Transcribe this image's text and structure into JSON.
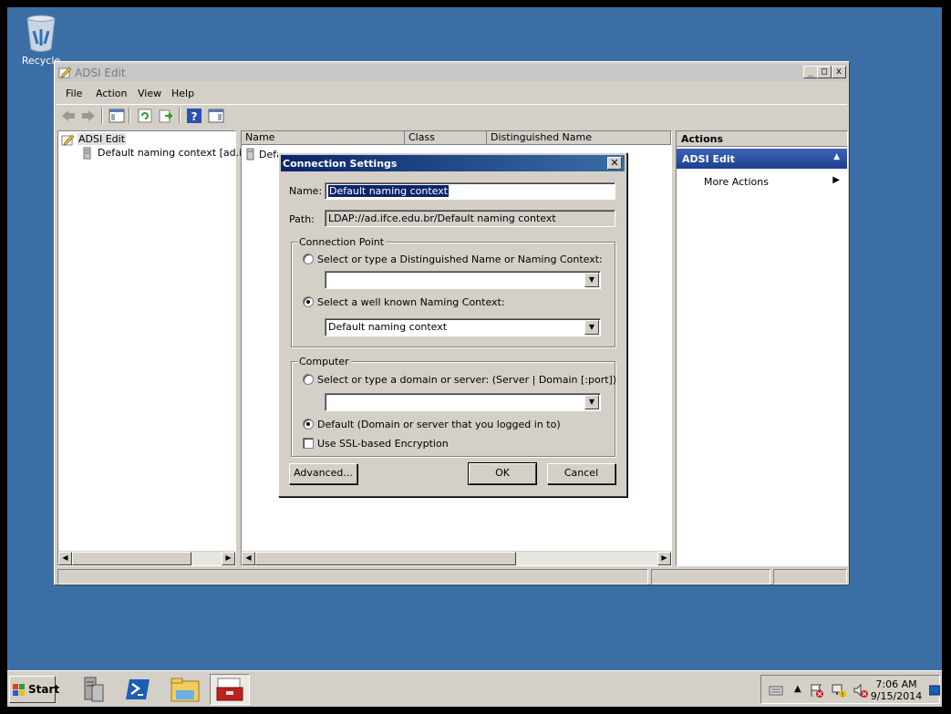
{
  "desktop": {
    "recycle_bin_label": "Recycle"
  },
  "window": {
    "title": "ADSI Edit",
    "minimize": "_",
    "maximize": "□",
    "close": "x",
    "menu": [
      "File",
      "Action",
      "View",
      "Help"
    ],
    "tree": {
      "root": "ADSI Edit",
      "child": "Default naming context [ad.ifce"
    },
    "list": {
      "columns": [
        "Name",
        "Class",
        "Distinguished Name"
      ],
      "row_name": "Defa"
    },
    "actions": {
      "header": "Actions",
      "section": "ADSI Edit",
      "item": "More Actions"
    }
  },
  "dialog": {
    "title": "Connection Settings",
    "name_label": "Name:",
    "name_value": "Default naming context",
    "path_label": "Path:",
    "path_value": "LDAP://ad.ifce.edu.br/Default naming context",
    "connection_point": {
      "label": "Connection Point",
      "option_dn": "Select or type a Distinguished Name or Naming Context:",
      "dn_value": "",
      "option_known": "Select a well known Naming Context:",
      "known_value": "Default naming context",
      "selected": "known"
    },
    "computer": {
      "label": "Computer",
      "option_server": "Select or type a domain or server: (Server | Domain [:port])",
      "server_value": "",
      "option_default": "Default (Domain or server that you logged in to)",
      "selected": "default",
      "ssl_label": "Use SSL-based Encryption",
      "ssl_checked": false
    },
    "buttons": {
      "advanced": "Advanced...",
      "ok": "OK",
      "cancel": "Cancel"
    }
  },
  "taskbar": {
    "start": "Start",
    "clock_time": "7:06 AM",
    "clock_date": "9/15/2014",
    "pinned": [
      "server-manager-icon",
      "powershell-icon",
      "explorer-icon",
      "adsi-edit-toolbox-icon"
    ]
  },
  "colors": {
    "desktop": "#3b6ea5",
    "title_active": "#0a246a",
    "chrome": "#d4d0c8",
    "actions_header": "#1c3f8e"
  }
}
